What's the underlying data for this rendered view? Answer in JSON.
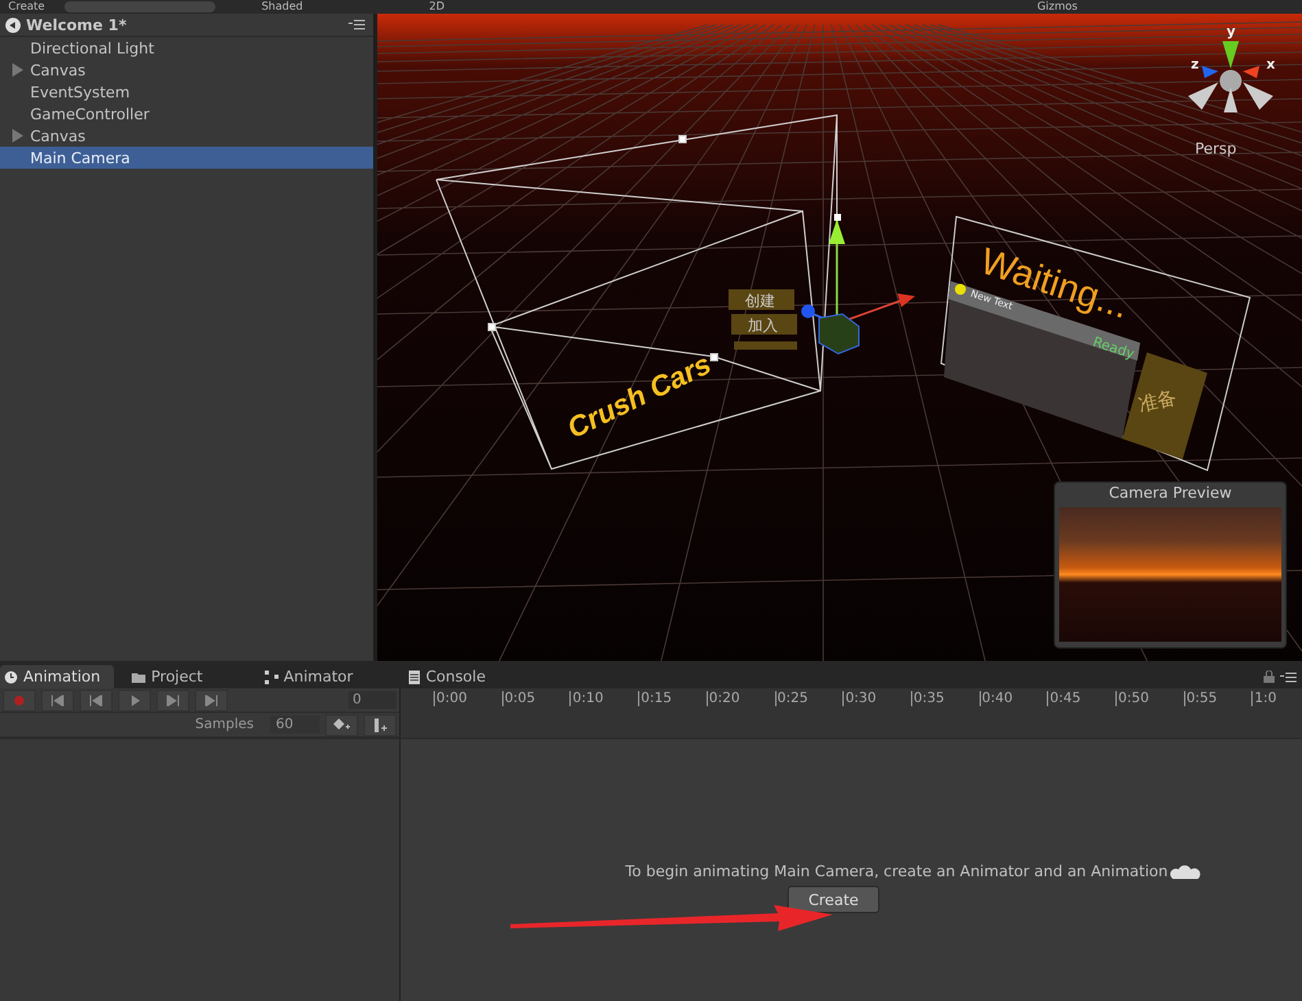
{
  "toolbar": {
    "create_button": "Create",
    "shading": "Shaded",
    "mode_2d": "2D",
    "gizmos": "Gizmos"
  },
  "hierarchy": {
    "scene": "Welcome 1*",
    "items": [
      {
        "label": "Directional Light",
        "has_children": false,
        "selected": false
      },
      {
        "label": "Canvas",
        "has_children": true,
        "selected": false
      },
      {
        "label": "EventSystem",
        "has_children": false,
        "selected": false
      },
      {
        "label": "GameController",
        "has_children": false,
        "selected": false
      },
      {
        "label": "Canvas",
        "has_children": true,
        "selected": false
      },
      {
        "label": "Main Camera",
        "has_children": false,
        "selected": true
      }
    ]
  },
  "scene_view": {
    "title_text": "Crush Cars",
    "menu_buttons": [
      "创建",
      "加入"
    ],
    "status_text": "Waiting...",
    "player_row": {
      "name": "New Text",
      "status": "Ready"
    },
    "ready_button": "准备",
    "axes": {
      "x": "x",
      "y": "y",
      "z": "z"
    },
    "projection": "Persp",
    "camera_preview": {
      "title": "Camera Preview"
    }
  },
  "animation": {
    "tabs": [
      {
        "label": "Animation",
        "kind": "clock",
        "selected": true
      },
      {
        "label": "Project",
        "kind": "folder",
        "selected": false
      },
      {
        "label": "Animator",
        "kind": "nodes",
        "selected": false
      },
      {
        "label": "Console",
        "kind": "console",
        "selected": false
      }
    ],
    "frame_field": "0",
    "timeline_ticks": [
      "0:00",
      "0:05",
      "0:10",
      "0:15",
      "0:20",
      "0:25",
      "0:30",
      "0:35",
      "0:40",
      "0:45",
      "0:50",
      "0:55",
      "1:0"
    ],
    "samples_label": "Samples",
    "samples_value": "60",
    "message": "To begin animating Main Camera, create an Animator and an Animation",
    "create_button": "Create"
  }
}
